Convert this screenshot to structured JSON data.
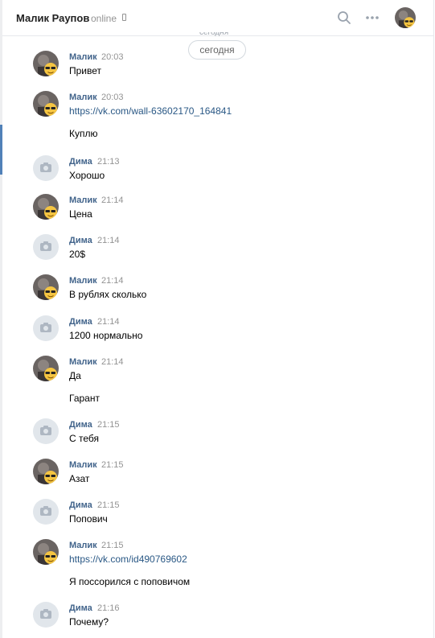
{
  "header": {
    "title": "Малик Раупов",
    "status": "online"
  },
  "date_ghost": "сегодня",
  "date_label": "сегодня",
  "messages": [
    {
      "author": "Малик",
      "time": "20:03",
      "lines": [
        "Привет"
      ]
    },
    {
      "author": "Малик",
      "time": "20:03",
      "link": "https://vk.com/wall-63602170_164841",
      "lines": [
        "Куплю"
      ]
    },
    {
      "author": "Дима",
      "time": "21:13",
      "lines": [
        "Хорошо"
      ]
    },
    {
      "author": "Малик",
      "time": "21:14",
      "lines": [
        "Цена"
      ]
    },
    {
      "author": "Дима",
      "time": "21:14",
      "lines": [
        "20$"
      ]
    },
    {
      "author": "Малик",
      "time": "21:14",
      "lines": [
        "В рублях сколько"
      ]
    },
    {
      "author": "Дима",
      "time": "21:14",
      "lines": [
        "1200 нормально"
      ]
    },
    {
      "author": "Малик",
      "time": "21:14",
      "lines": [
        "Да",
        "Гарант"
      ]
    },
    {
      "author": "Дима",
      "time": "21:15",
      "lines": [
        "С тебя"
      ]
    },
    {
      "author": "Малик",
      "time": "21:15",
      "lines": [
        "Азат"
      ]
    },
    {
      "author": "Дима",
      "time": "21:15",
      "lines": [
        "Попович"
      ]
    },
    {
      "author": "Малик",
      "time": "21:15",
      "link": "https://vk.com/id490769602",
      "lines": [
        "Я поссорился с поповичом"
      ]
    },
    {
      "author": "Дима",
      "time": "21:16",
      "lines": [
        "Почему?"
      ]
    }
  ]
}
